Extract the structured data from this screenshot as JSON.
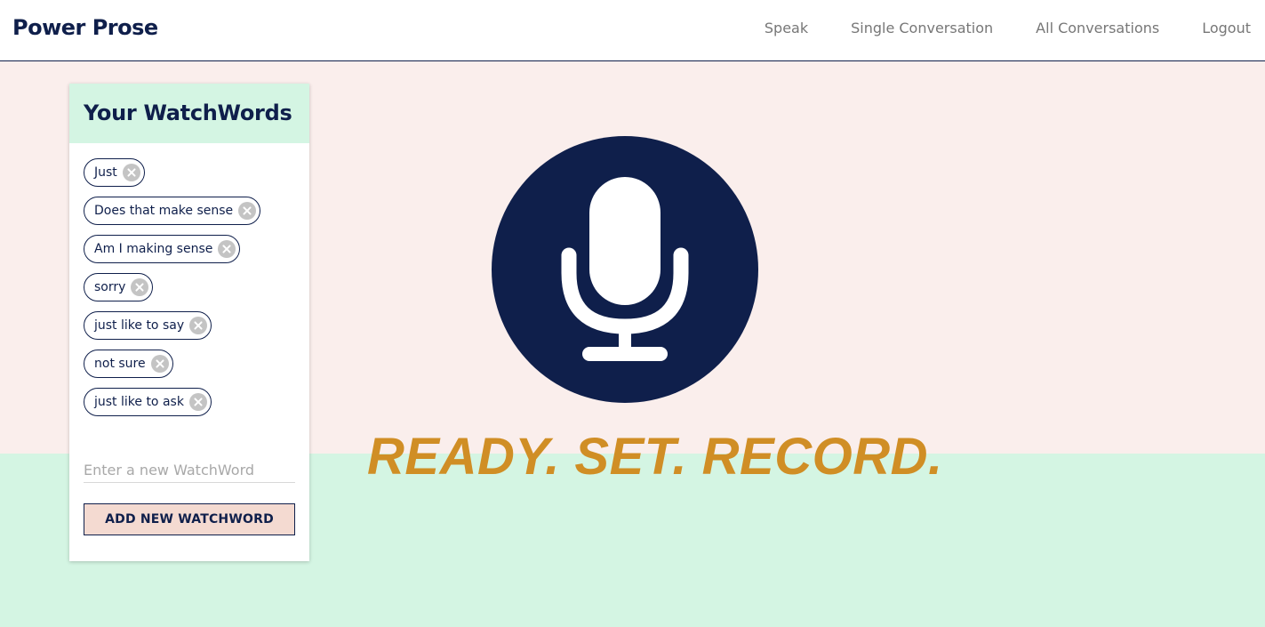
{
  "navbar": {
    "brand": "Power Prose",
    "links": [
      "Speak",
      "Single Conversation",
      "All Conversations",
      "Logout"
    ]
  },
  "watchwords": {
    "title": "Your WatchWords",
    "items": [
      "Just",
      "Does that make sense",
      "Am I making sense",
      "sorry",
      "just like to say",
      "not sure",
      "just like to ask"
    ],
    "input_placeholder": "Enter a new WatchWord",
    "add_button_label": "ADD NEW WATCHWORD"
  },
  "recorder": {
    "icon": "microphone-icon",
    "tagline": "READY. SET. RECORD."
  },
  "colors": {
    "navy": "#0f1f4b",
    "accent_orange": "#d08e25",
    "mint": "#d4f5e3",
    "blush": "#faeeec",
    "button_fill": "#f4dad1"
  }
}
